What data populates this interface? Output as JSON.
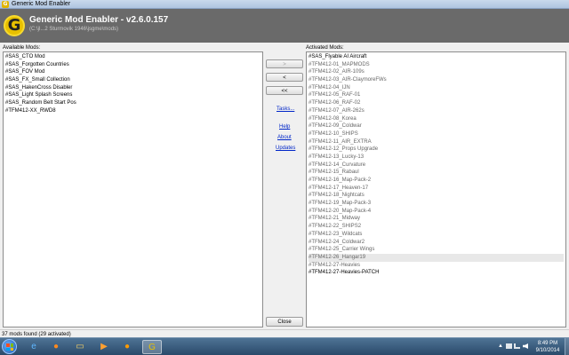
{
  "window": {
    "title": "Generic Mod Enabler",
    "app_icon_letter": "G"
  },
  "header": {
    "app_name": "Generic Mod Enabler - v2.6.0.157",
    "path": "(C:\\jl...2 Sturmovik 1946\\jsgme\\mods)"
  },
  "available": {
    "label": "Available Mods:",
    "items": [
      "#SAS_CTO Mod",
      "#SAS_Forgotten Countries",
      "#SAS_FOV Mod",
      "#SAS_FX_Small Collection",
      "#SAS_HakenCross Disabler",
      "#SAS_Light Splash Screens",
      "#SAS_Random Belt Start Pos",
      "#TFM412-XX_RWD8"
    ]
  },
  "activated": {
    "label": "Activated Mods:",
    "items": [
      {
        "text": "#SAS_Flyable AI Aircraft",
        "state": "normal"
      },
      {
        "text": "#TFM412-01_MAPMODS",
        "state": "dim"
      },
      {
        "text": "#TFM412-02_AIR-109s",
        "state": "dim"
      },
      {
        "text": "#TFM412-03_AIR-ClaymoreFWs",
        "state": "dim"
      },
      {
        "text": "#TFM412-04_IJN",
        "state": "dim"
      },
      {
        "text": "#TFM412-05_RAF-01",
        "state": "dim"
      },
      {
        "text": "#TFM412-06_RAF-02",
        "state": "dim"
      },
      {
        "text": "#TFM412-07_AIR-262s",
        "state": "dim"
      },
      {
        "text": "#TFM412-08_Korea",
        "state": "dim"
      },
      {
        "text": "#TFM412-09_Coldwar",
        "state": "dim"
      },
      {
        "text": "#TFM412-10_SHIPS",
        "state": "dim"
      },
      {
        "text": "#TFM412-11_AIR_EXTRA",
        "state": "dim"
      },
      {
        "text": "#TFM412-12_Props Upgrade",
        "state": "dim"
      },
      {
        "text": "#TFM412-13_Lucky-13",
        "state": "dim"
      },
      {
        "text": "#TFM412-14_Curvature",
        "state": "dim"
      },
      {
        "text": "#TFM412-15_Rabaul",
        "state": "dim"
      },
      {
        "text": "#TFM412-16_Map-Pack-2",
        "state": "dim"
      },
      {
        "text": "#TFM412-17_Heaven-17",
        "state": "dim"
      },
      {
        "text": "#TFM412-18_Nightcats",
        "state": "dim"
      },
      {
        "text": "#TFM412-19_Map-Pack-3",
        "state": "dim"
      },
      {
        "text": "#TFM412-20_Map-Pack-4",
        "state": "dim"
      },
      {
        "text": "#TFM412-21_Midway",
        "state": "dim"
      },
      {
        "text": "#TFM412-22_SHIPS2",
        "state": "dim"
      },
      {
        "text": "#TFM412-23_Wildcats",
        "state": "dim"
      },
      {
        "text": "#TFM412-24_Coldwar2",
        "state": "dim"
      },
      {
        "text": "#TFM412-25_Carrier Wings",
        "state": "dim"
      },
      {
        "text": "#TFM412-26_Hangar19",
        "state": "selected"
      },
      {
        "text": "#TFM412-27-Heavies",
        "state": "dim"
      },
      {
        "text": "#TFM412-27-Heavies-PATCH",
        "state": "normal"
      }
    ]
  },
  "controls": {
    "move_right": ">",
    "move_left": "<",
    "move_all_left": "<<",
    "tasks": "Tasks...",
    "help": "Help",
    "about": "About",
    "updates": "Updates",
    "close": "Close"
  },
  "status": "37 mods found (29 activated)",
  "taskbar": {
    "apps": [
      {
        "icon": "internet-explorer-icon",
        "glyph": "e",
        "color": "#5fb7ff"
      },
      {
        "icon": "firefox-icon",
        "glyph": "●",
        "color": "#ff8a1e"
      },
      {
        "icon": "folder-icon",
        "glyph": "▭",
        "color": "#f2cf66"
      },
      {
        "icon": "media-player-icon",
        "glyph": "▶",
        "color": "#ffa030"
      },
      {
        "icon": "media-center-icon",
        "glyph": "●",
        "color": "#ff9a00"
      },
      {
        "icon": "generic-mod-enabler-icon",
        "glyph": "G",
        "color": "#e8c000"
      }
    ],
    "time": "8:49 PM",
    "date": "9/10/2014",
    "tray_expand": "▲"
  },
  "colors": {
    "link": "#0026c8",
    "header_bg": "#6a6a6a",
    "logo_yellow": "#e8c000"
  }
}
